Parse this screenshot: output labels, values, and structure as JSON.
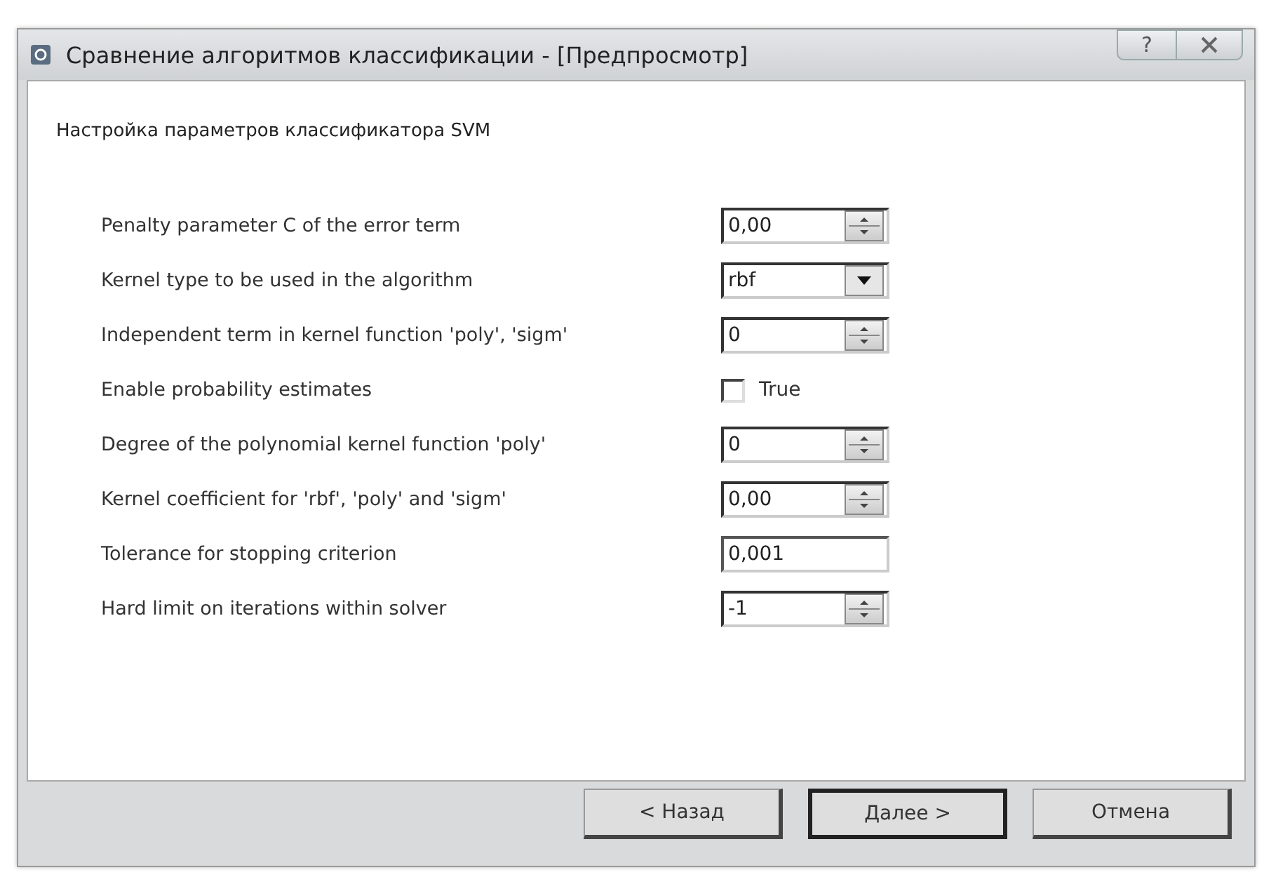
{
  "window": {
    "title": "Сравнение алгоритмов классификации - [Предпросмотр]",
    "help_button": "?"
  },
  "heading": "Настройка параметров классификатора SVM",
  "parameters": [
    {
      "label": "Penalty parameter C of the error term",
      "kind": "spin",
      "value": "0,00"
    },
    {
      "label": "Kernel type to be used in the algorithm",
      "kind": "combo",
      "value": "rbf"
    },
    {
      "label": "Independent term in kernel function 'poly', 'sigm'",
      "kind": "spin",
      "value": "0"
    },
    {
      "label": "Enable probability estimates",
      "kind": "checkbox",
      "value": "True",
      "checked": false
    },
    {
      "label": "Degree of the polynomial kernel function 'poly'",
      "kind": "spin",
      "value": "0"
    },
    {
      "label": "Kernel coefficient for 'rbf', 'poly' and 'sigm'",
      "kind": "spin",
      "value": "0,00"
    },
    {
      "label": "Tolerance for stopping criterion",
      "kind": "text",
      "value": "0,001"
    },
    {
      "label": "Hard limit on iterations within solver",
      "kind": "spin",
      "value": "-1"
    }
  ],
  "buttons": [
    {
      "label": "< Назад",
      "default": false
    },
    {
      "label": "Далее >",
      "default": true
    },
    {
      "label": "Отмена",
      "default": false
    }
  ]
}
